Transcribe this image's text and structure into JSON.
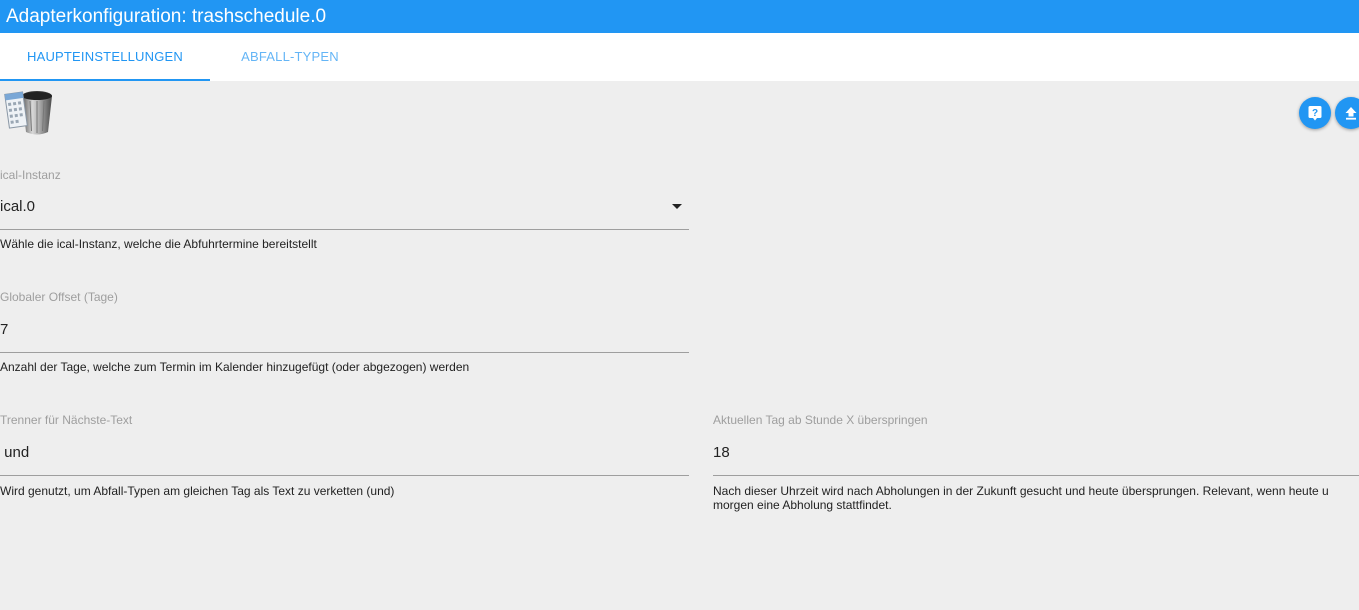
{
  "window": {
    "title": "Adapterkonfiguration: trashschedule.0"
  },
  "tabs": [
    {
      "label": "HAUPTEINSTELLUNGEN",
      "active": true
    },
    {
      "label": "ABFALL-TYPEN",
      "active": false
    }
  ],
  "toolbar": {
    "help_icon": "help-icon",
    "upload_icon": "upload-icon"
  },
  "logo": {
    "icon": "trash-can-icon"
  },
  "form": {
    "ical_instance": {
      "label": "ical-Instanz",
      "value": "ical.0",
      "helper": "Wähle die ical-Instanz, welche die Abfuhrtermine bereitstellt"
    },
    "global_offset": {
      "label": "Globaler Offset (Tage)",
      "value": "7",
      "helper": "Anzahl der Tage, welche zum Termin im Kalender hinzugefügt (oder abgezogen) werden"
    },
    "separator": {
      "label": "Trenner für Nächste-Text",
      "value": " und",
      "helper": "Wird genutzt, um Abfall-Typen am gleichen Tag als Text zu verketten (und)"
    },
    "skip_hour": {
      "label": "Aktuellen Tag ab Stunde X überspringen",
      "value": "18",
      "helper_line1": "Nach dieser Uhrzeit wird nach Abholungen in der Zukunft gesucht und heute übersprungen. Relevant, wenn heute u",
      "helper_line2": "morgen eine Abholung stattfindet."
    }
  },
  "colors": {
    "accent": "#2196f3",
    "background": "#eeeeee",
    "label": "#9e9e9e"
  }
}
